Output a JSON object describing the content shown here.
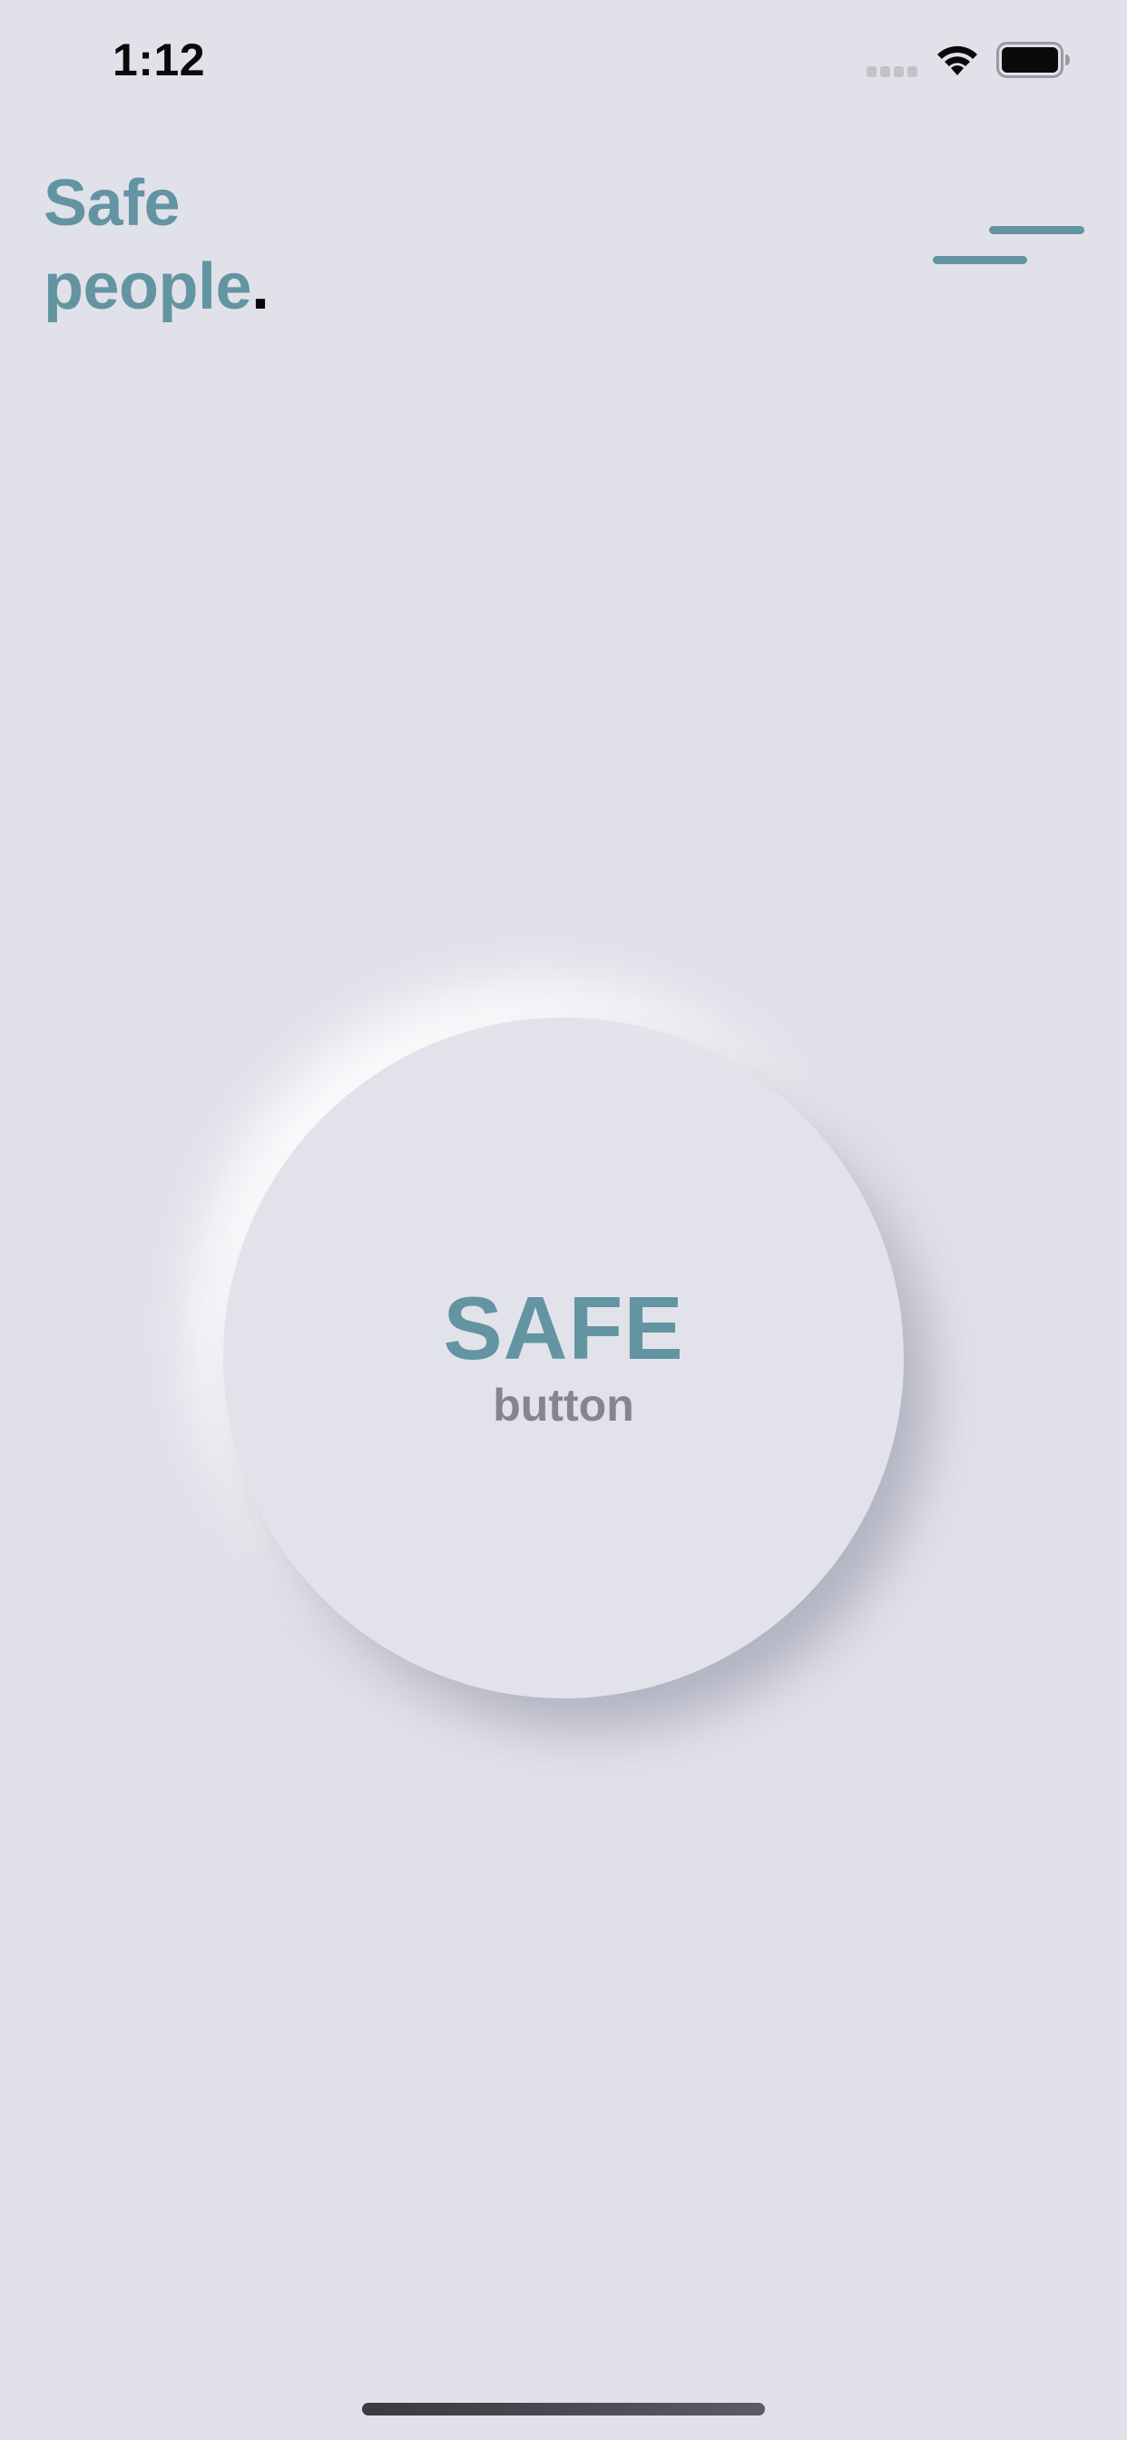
{
  "status_bar": {
    "time": "1:12",
    "signal_icon": "cellular-signal-icon",
    "wifi_icon": "wifi-icon",
    "battery_icon": "battery-icon"
  },
  "header": {
    "brand_line1": "Safe",
    "brand_line2": "people",
    "brand_dot": ".",
    "menu_icon": "hamburger-menu-icon"
  },
  "safe_button": {
    "title": "SAFE",
    "subtitle": "button"
  },
  "colors": {
    "background": "#e1e1ea",
    "accent": "#6394a2",
    "subtitle_gray": "#85858f",
    "text_dark": "#0a0a0a"
  }
}
